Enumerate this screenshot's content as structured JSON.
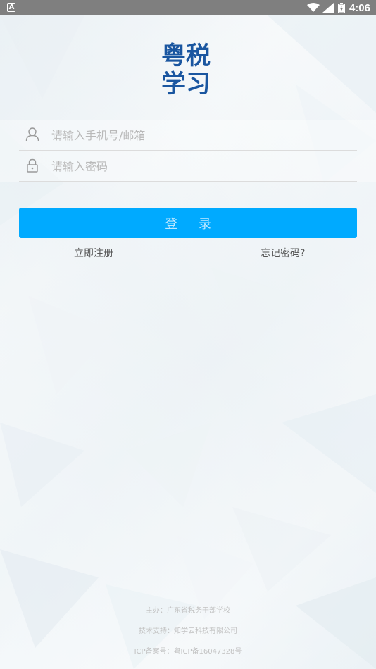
{
  "status_bar": {
    "notification_badge": "A",
    "time": "4:06",
    "icons": [
      "wifi-icon",
      "signal-icon",
      "battery-charging-icon"
    ]
  },
  "logo": {
    "line1": "粤税",
    "line2": "学习",
    "color": "#1a56a0"
  },
  "form": {
    "account_placeholder": "请输入手机号/邮箱",
    "password_placeholder": "请输入密码",
    "account_value": "",
    "password_value": ""
  },
  "actions": {
    "login_label": "登 录",
    "register_label": "立即注册",
    "forgot_label": "忘记密码?"
  },
  "footer": {
    "organizer": "主办：广东省税务干部学校",
    "tech_support": "技术支持：知学云科技有限公司",
    "icp": "ICP备案号：粤ICP备16047328号"
  },
  "colors": {
    "accent": "#00aaff",
    "status_bar": "#7f7f7f"
  }
}
